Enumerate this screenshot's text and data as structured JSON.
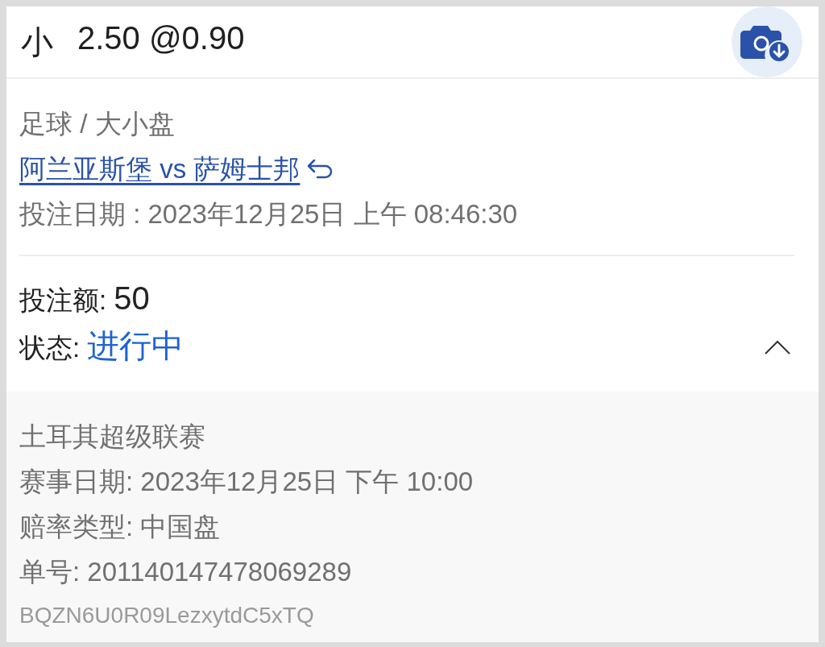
{
  "header": {
    "selection": "小",
    "line": "2.50 @0.90"
  },
  "match": {
    "category": "足球 / 大小盘",
    "teams": "阿兰亚斯堡 vs 萨姆士邦",
    "bet_date_label": "投注日期 : ",
    "bet_date": "2023年12月25日 上午 08:46:30"
  },
  "stake": {
    "label": "投注额:",
    "value": "50"
  },
  "status": {
    "label": "状态:",
    "value": "进行中"
  },
  "details": {
    "expanded": true,
    "league": "土耳其超级联赛",
    "rows": [
      {
        "label": "赛事日期: ",
        "value": "2023年12月25日 下午 10:00"
      },
      {
        "label": "赔率类型: ",
        "value": "中国盘"
      },
      {
        "label": "单号: ",
        "value": "201140147478069289"
      }
    ],
    "code": "BQZN6U0R09LezxytdC5xTQ"
  }
}
